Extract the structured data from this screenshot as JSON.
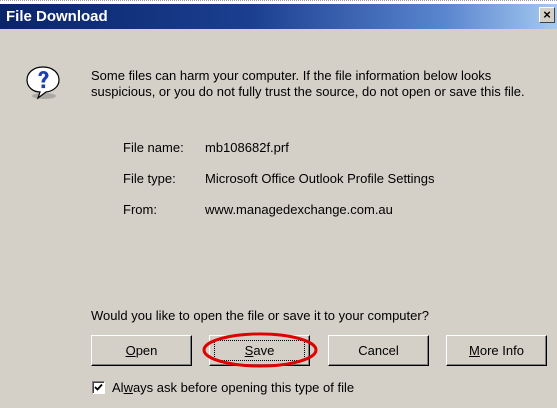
{
  "window": {
    "title": "File Download",
    "close_glyph": "×"
  },
  "message": {
    "warning": "Some files can harm your computer. If the file information below looks suspicious, or you do not fully trust the source, do not open or save this file.",
    "icon": "question-icon"
  },
  "file_info": {
    "name_label": "File name:",
    "name_value": "mb108682f.prf",
    "type_label": "File type:",
    "type_value": "Microsoft Office Outlook Profile Settings",
    "from_label": "From:",
    "from_value": "www.managedexchange.com.au"
  },
  "prompt": "Would you like to open the file or save it to your computer?",
  "buttons": {
    "open": {
      "hotkey": "O",
      "rest": "pen"
    },
    "save": {
      "hotkey": "S",
      "rest": "ave"
    },
    "cancel": {
      "label": "Cancel"
    },
    "more_info": {
      "hotkey": "M",
      "rest": "ore Info"
    }
  },
  "checkbox": {
    "before": "Al",
    "hotkey": "w",
    "after": "ays ask before opening this type of file",
    "checked": true
  },
  "highlight": {
    "target": "save-button",
    "color": "#e00000"
  }
}
